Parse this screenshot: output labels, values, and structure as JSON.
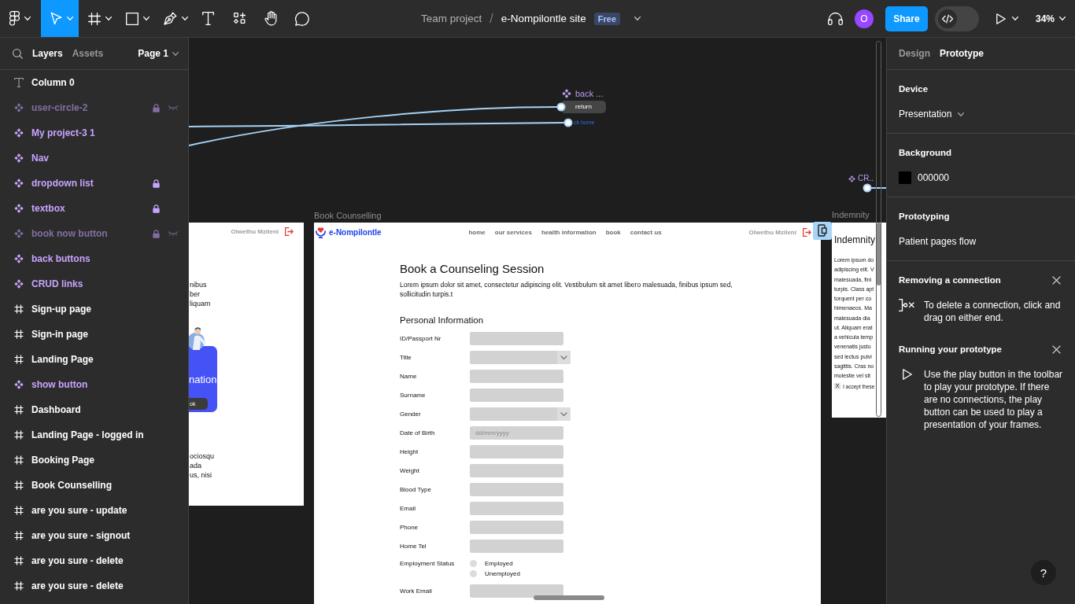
{
  "toolbar": {
    "tools": [
      {
        "kind": "logo",
        "caret": true,
        "selected": false
      },
      {
        "kind": "move",
        "caret": true,
        "selected": true
      },
      {
        "kind": "frame",
        "caret": true,
        "selected": false
      },
      {
        "kind": "shape",
        "caret": true,
        "selected": false
      },
      {
        "kind": "pen",
        "caret": true,
        "selected": false
      },
      {
        "kind": "text",
        "caret": false,
        "selected": false
      },
      {
        "kind": "actions",
        "caret": false,
        "selected": false
      },
      {
        "kind": "hand",
        "caret": false,
        "selected": false
      },
      {
        "kind": "comment",
        "caret": false,
        "selected": false
      }
    ],
    "file": {
      "team": "Team project",
      "separator": "/",
      "name": "e-Nompilontle site",
      "badge": "Free"
    },
    "avatar": "O",
    "share": "Share",
    "dev_mode": {
      "on": false
    },
    "zoom": "34%"
  },
  "layers_panel": {
    "tabs": [
      {
        "label": "Layers",
        "selected": true
      },
      {
        "label": "Assets",
        "selected": false
      }
    ],
    "page": "Page 1",
    "layers": [
      {
        "name": "Column 0",
        "kind": "text",
        "locked": false,
        "hidden": false
      },
      {
        "name": "user-circle-2",
        "kind": "component",
        "locked": true,
        "hidden": true
      },
      {
        "name": "My project-3 1",
        "kind": "component",
        "locked": false,
        "hidden": false
      },
      {
        "name": "Nav",
        "kind": "component",
        "locked": false,
        "hidden": false
      },
      {
        "name": "dropdown list",
        "kind": "component",
        "locked": true,
        "hidden": false
      },
      {
        "name": "textbox",
        "kind": "component",
        "locked": true,
        "hidden": false
      },
      {
        "name": "book now button",
        "kind": "component",
        "locked": true,
        "hidden": true
      },
      {
        "name": "back buttons",
        "kind": "component",
        "locked": false,
        "hidden": false
      },
      {
        "name": "CRUD links",
        "kind": "component",
        "locked": false,
        "hidden": false
      },
      {
        "name": "Sign-up page",
        "kind": "frame",
        "locked": false,
        "hidden": false
      },
      {
        "name": "Sign-in page",
        "kind": "frame",
        "locked": false,
        "hidden": false
      },
      {
        "name": "Landing Page",
        "kind": "frame",
        "locked": false,
        "hidden": false
      },
      {
        "name": "show button",
        "kind": "component",
        "locked": false,
        "hidden": false
      },
      {
        "name": "Dashboard",
        "kind": "frame",
        "locked": false,
        "hidden": false
      },
      {
        "name": "Landing Page - logged in",
        "kind": "frame",
        "locked": false,
        "hidden": false
      },
      {
        "name": "Booking Page",
        "kind": "frame",
        "locked": false,
        "hidden": false
      },
      {
        "name": "Book Counselling",
        "kind": "frame",
        "locked": false,
        "hidden": false
      },
      {
        "name": "are you sure - update",
        "kind": "frame",
        "locked": false,
        "hidden": false
      },
      {
        "name": "are you sure - signout",
        "kind": "frame",
        "locked": false,
        "hidden": false
      },
      {
        "name": "are you sure - delete",
        "kind": "frame",
        "locked": false,
        "hidden": false
      },
      {
        "name": "are you sure - delete",
        "kind": "frame",
        "locked": false,
        "hidden": false
      }
    ]
  },
  "canvas": {
    "back_component": {
      "label": "back ...",
      "button": "return",
      "link": "ck home"
    },
    "crud_component": {
      "label": "CR.."
    },
    "left_frame": {
      "user_name": "Olwethu Mzileni",
      "text_top": [
        "nibus",
        "ber",
        "liquam"
      ],
      "card_title": "nation",
      "card_button": "ok",
      "text_bottom": [
        "ociosqu",
        "ada",
        "us, nisi"
      ]
    },
    "booking_frame": {
      "label": "Book Counselling",
      "brand": "e-Nompilontle",
      "nav": [
        "home",
        "our services",
        "health information",
        "book",
        "contact us"
      ],
      "user_name": "Olwethu Mzileni",
      "title": "Book a Counseling Session",
      "intro": "Lorem ipsum dolor sit amet, consectetur adipiscing elit. Vestibulum sit amet libero malesuada, finibus ipsum sed, sollicitudin turpis.t",
      "section": "Personal Information",
      "fields": [
        {
          "label": "ID/Passport Nr",
          "kind": "text"
        },
        {
          "label": "Title",
          "kind": "select"
        },
        {
          "label": "Name",
          "kind": "text"
        },
        {
          "label": "Surname",
          "kind": "text"
        },
        {
          "label": "Gender",
          "kind": "select"
        },
        {
          "label": "Date of Birth",
          "kind": "text",
          "placeholder": "dd/mm/yyyy"
        },
        {
          "label": "Height",
          "kind": "text"
        },
        {
          "label": "Weight",
          "kind": "text"
        },
        {
          "label": "Blood Type",
          "kind": "text"
        },
        {
          "label": "Email",
          "kind": "text"
        },
        {
          "label": "Phone",
          "kind": "text"
        },
        {
          "label": "Home Tel",
          "kind": "text"
        },
        {
          "label": "Employment Status",
          "kind": "radio",
          "options": [
            {
              "label": "Employed",
              "selected": false
            },
            {
              "label": "Unemployed",
              "selected": false
            }
          ]
        },
        {
          "label": "Work Email",
          "kind": "text"
        }
      ]
    },
    "indemnity_frame": {
      "label": "Indemnity",
      "title": "Indemnity",
      "lines": [
        "Lorem ipsum do",
        "adipiscing elit. V",
        "malesuada, fini",
        "turpis. Class apt",
        "torquent per co",
        "himenaeos. Ma",
        "malesuada dia",
        "ut. Aliquam erat",
        "a vehicula temp",
        "venenatis justo",
        "sed lectus pulvi",
        "sagittis. Cras no",
        "molestie vel sit"
      ],
      "checkbox": {
        "checked": true,
        "mark": "X"
      },
      "accept": "I accept these"
    }
  },
  "properties_panel": {
    "tabs": [
      {
        "label": "Design",
        "selected": false
      },
      {
        "label": "Prototype",
        "selected": true
      }
    ],
    "sections": [
      {
        "kind": "dropdown",
        "title": "Device",
        "value": "Presentation"
      },
      {
        "kind": "color",
        "title": "Background",
        "value": "000000"
      },
      {
        "kind": "flow",
        "title": "Prototyping",
        "value": "Patient pages flow"
      }
    ],
    "tips": [
      {
        "kind": "disconnect",
        "title": "Removing a connection",
        "text": "To delete a connection, click and drag on either end."
      },
      {
        "kind": "play",
        "title": "Running your prototype",
        "text": "Use the play button in the toolbar to play your prototype. If there are no connections, the play button can be used to play a presentation of your frames."
      }
    ],
    "help": "?"
  }
}
